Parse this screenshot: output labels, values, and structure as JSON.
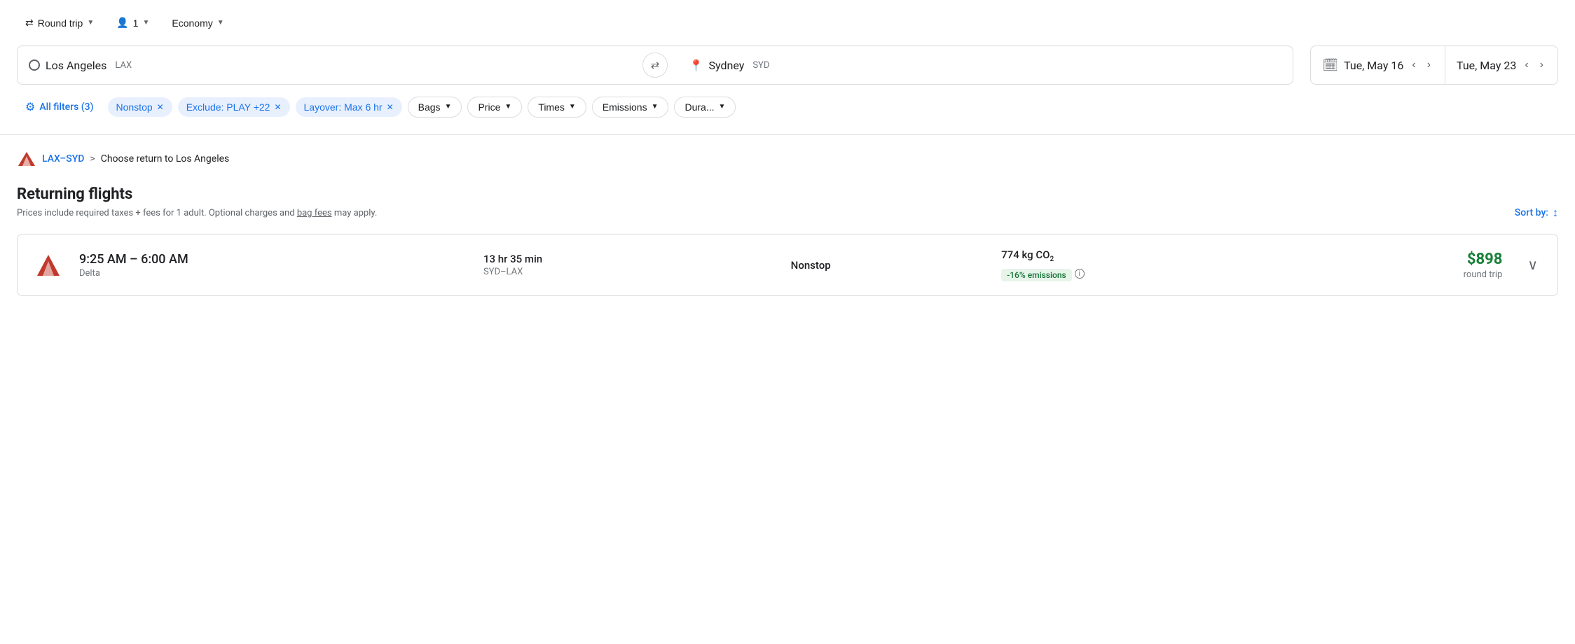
{
  "toolbar": {
    "trip_type_label": "Round trip",
    "passengers_label": "1",
    "cabin_label": "Economy"
  },
  "search": {
    "origin_name": "Los Angeles",
    "origin_code": "LAX",
    "destination_name": "Sydney",
    "destination_code": "SYD",
    "date_depart": "Tue, May 16",
    "date_return": "Tue, May 23",
    "swap_label": "⇄",
    "calendar_icon": "📅"
  },
  "filters": {
    "all_filters_label": "All filters (3)",
    "chips": [
      {
        "label": "Nonstop",
        "removable": true
      },
      {
        "label": "Exclude: PLAY +22",
        "removable": true
      },
      {
        "label": "Layover: Max 6 hr",
        "removable": true
      }
    ],
    "dropdowns": [
      {
        "label": "Bags"
      },
      {
        "label": "Price"
      },
      {
        "label": "Times"
      },
      {
        "label": "Emissions"
      },
      {
        "label": "Dura..."
      }
    ]
  },
  "breadcrumb": {
    "route_link": "LAX–SYD",
    "separator": ">",
    "current": "Choose return to Los Angeles"
  },
  "results": {
    "section_title": "Returning flights",
    "subtitle_text": "Prices include required taxes + fees for 1 adult. Optional charges and ",
    "bag_fees_text": "bag fees",
    "subtitle_end": " may apply.",
    "sort_label": "Sort by:"
  },
  "flights": [
    {
      "airline": "Delta",
      "time_range": "9:25 AM – 6:00 AM",
      "duration": "13 hr 35 min",
      "route": "SYD–LAX",
      "stops": "Nonstop",
      "emissions_amount": "774 kg CO₂",
      "emissions_badge": "-16% emissions",
      "price": "$898",
      "price_label": "round trip"
    }
  ],
  "colors": {
    "blue": "#1a73e8",
    "green": "#188038",
    "green_badge_bg": "#e6f4ea",
    "green_badge_text": "#137333",
    "filter_chip_bg": "#e8f0fe",
    "border": "#dadce0",
    "text_secondary": "#70757a"
  }
}
